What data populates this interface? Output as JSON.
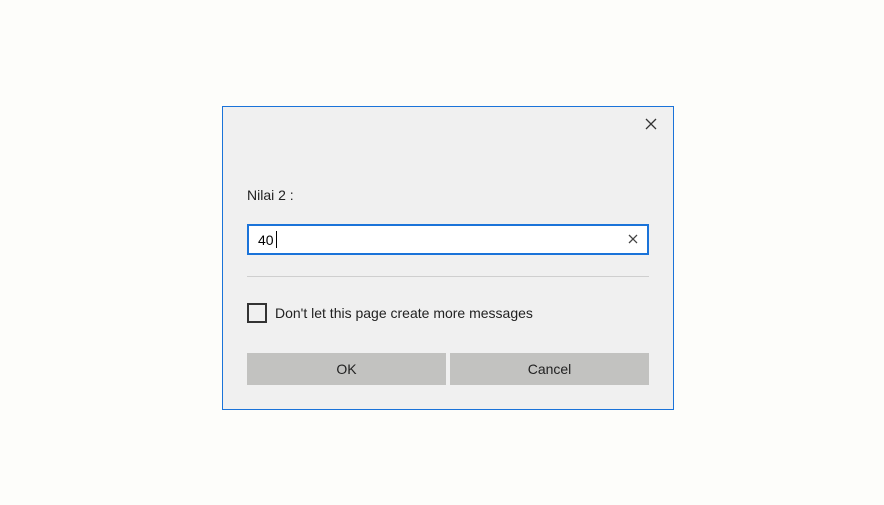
{
  "dialog": {
    "prompt_label": "Nilai 2 :",
    "input_value": "40",
    "checkbox_label": "Don't let this page create more messages",
    "checkbox_checked": false,
    "ok_label": "OK",
    "cancel_label": "Cancel"
  },
  "icons": {
    "close": "close-icon",
    "clear": "clear-icon"
  },
  "colors": {
    "accent": "#1a73d9",
    "dialog_bg": "#f0f0f0",
    "button_bg": "#c2c2c0"
  }
}
